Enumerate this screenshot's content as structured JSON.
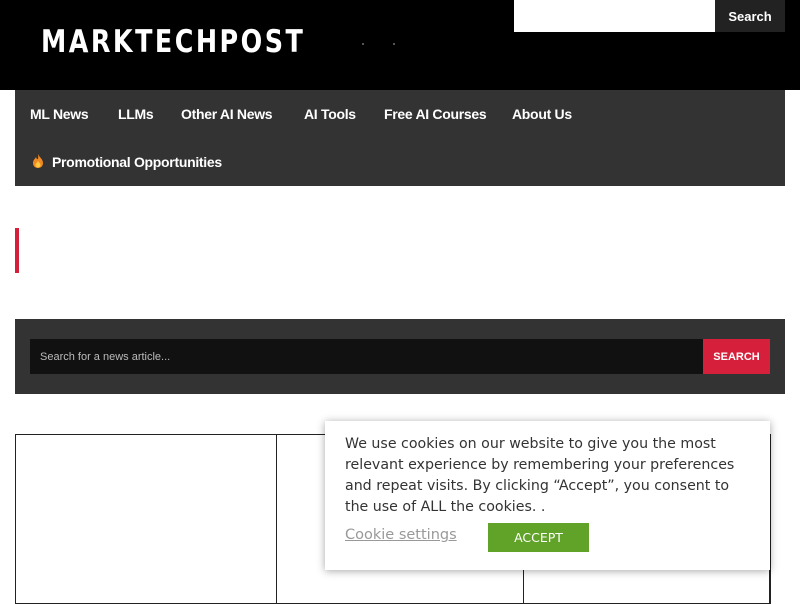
{
  "header": {
    "logo": "MARKTECHPOST",
    "search_button_label": "Search",
    "search_value": ""
  },
  "nav": {
    "items": [
      {
        "label": "ML News"
      },
      {
        "label": "LLMs"
      },
      {
        "label": "Other AI News"
      },
      {
        "label": "AI Tools"
      },
      {
        "label": "Free AI Courses"
      },
      {
        "label": "About Us"
      },
      {
        "label": "Promotional Opportunities",
        "icon": "flame-icon"
      }
    ]
  },
  "news_search": {
    "placeholder": "Search for a news article...",
    "button_label": "SEARCH"
  },
  "cookie_banner": {
    "text": "We use cookies on our website to give you the most relevant experience by remembering your preferences and repeat visits. By clicking “Accept”, you consent to the use of ALL the cookies. .",
    "settings_label": "Cookie settings",
    "accept_label": "ACCEPT"
  },
  "colors": {
    "header_bg": "#000000",
    "nav_bg": "#333333",
    "accent_red": "#d61f3a",
    "accept_green": "#61a229"
  }
}
